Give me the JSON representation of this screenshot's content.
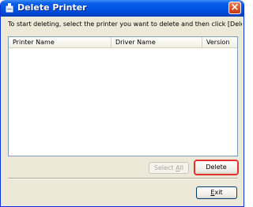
{
  "window": {
    "title": "Delete Printer",
    "close_glyph": "×"
  },
  "instruction": "To start deleting, select the printer you want to delete and then click [Delete].",
  "list": {
    "columns": [
      "Printer Name",
      "Driver Name",
      "Version"
    ],
    "rows": []
  },
  "buttons": {
    "select_all_prefix": "Select ",
    "select_all_mnemonic": "A",
    "select_all_suffix": "ll",
    "delete": "Delete",
    "exit_mnemonic": "E",
    "exit_suffix": "xit"
  },
  "colors": {
    "titlebar": "#0054e3",
    "close": "#d5522c",
    "delete_highlight": "#e03030"
  },
  "icons": {
    "title": "printer-delete-icon",
    "close": "close-icon"
  }
}
